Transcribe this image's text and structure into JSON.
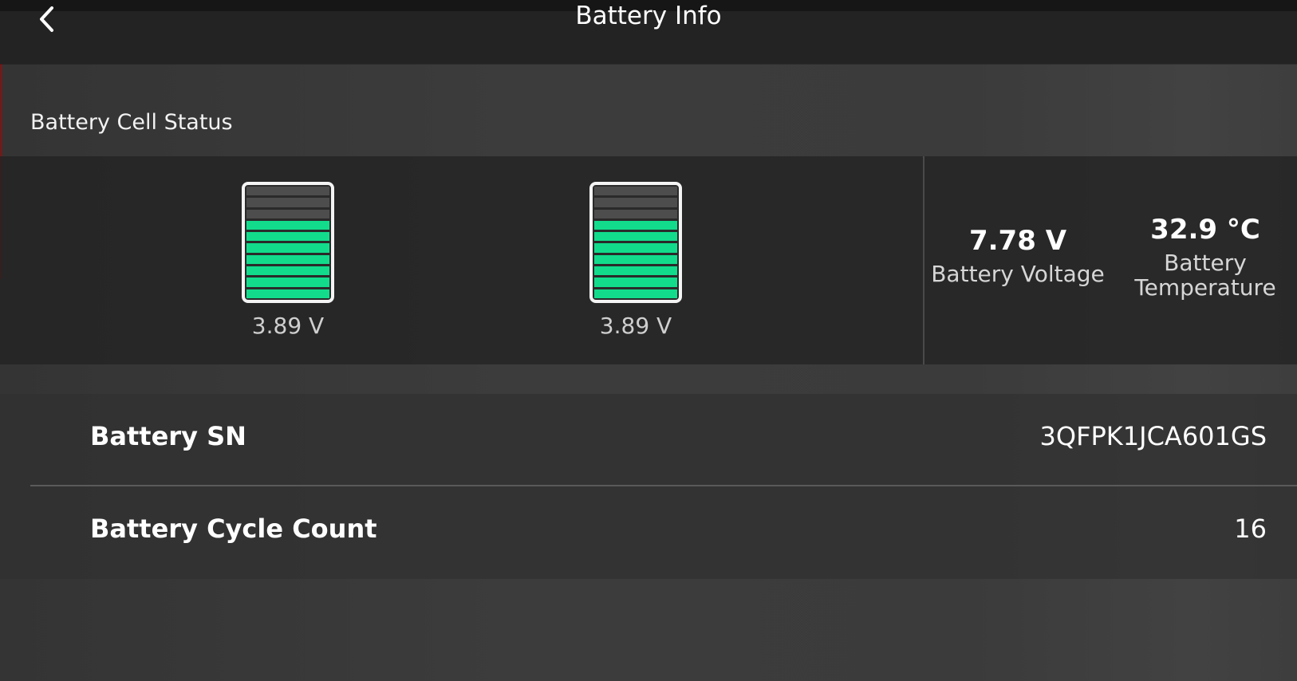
{
  "header": {
    "title": "Battery Info",
    "back_icon": "chevron-left-icon"
  },
  "cell_status": {
    "section_title": "Battery Cell Status",
    "cells": [
      {
        "voltage": "3.89 V",
        "level_fraction": 0.7,
        "segments_total": 10,
        "segments_filled": 7
      },
      {
        "voltage": "3.89 V",
        "level_fraction": 0.7,
        "segments_total": 10,
        "segments_filled": 7
      }
    ],
    "fill_color": "#12dc8c",
    "empty_color": "#4d4d4d"
  },
  "summary": {
    "voltage_value": "7.78 V",
    "voltage_label": "Battery Voltage",
    "temperature_value": "32.9 °C",
    "temperature_label": "Battery Temperature"
  },
  "details": {
    "rows": [
      {
        "label": "Battery SN",
        "value": "3QFPK1JCA601GS"
      },
      {
        "label": "Battery Cycle Count",
        "value": "16"
      }
    ]
  }
}
